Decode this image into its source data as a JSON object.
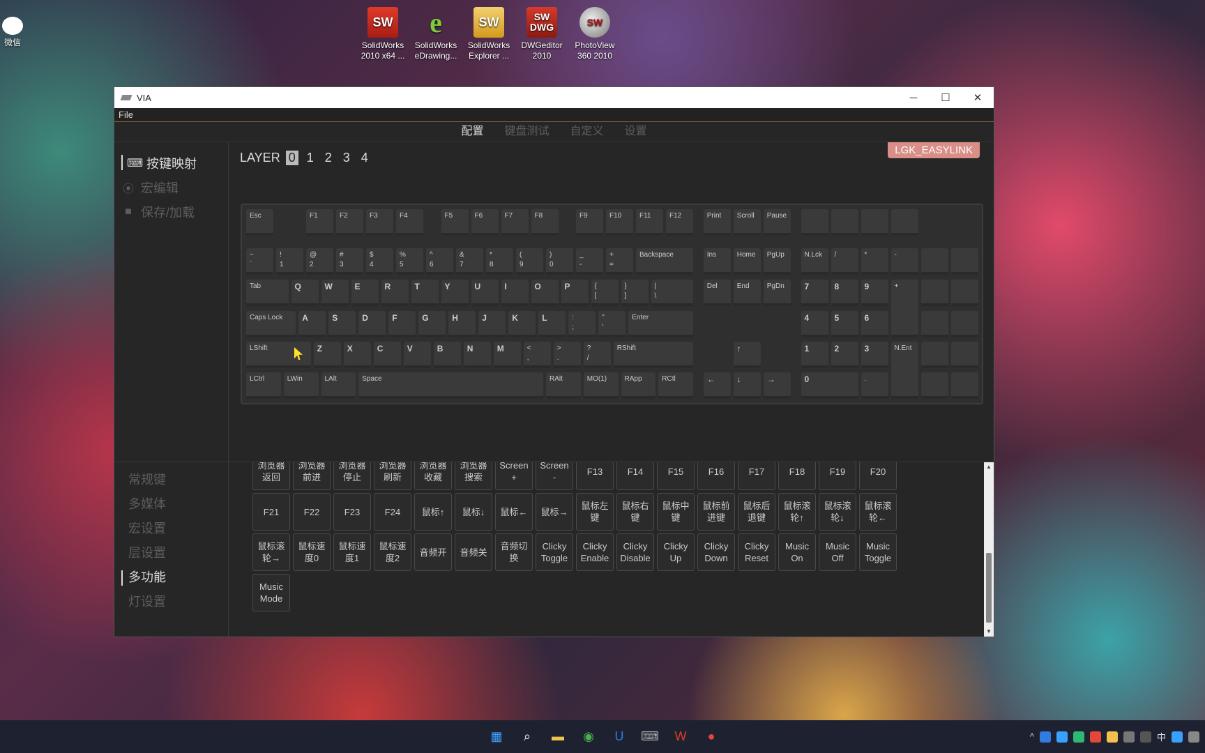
{
  "desktop_icons": [
    {
      "label": "微信",
      "icon": "wechat-icon"
    },
    {
      "label": "SolidWorks 2010 x64 ...",
      "icon": "solidworks-icon",
      "glyph": "SW"
    },
    {
      "label": "SolidWorks eDrawing...",
      "icon": "edrawings-icon",
      "glyph": "e"
    },
    {
      "label": "SolidWorks Explorer ...",
      "icon": "sw-explorer-icon",
      "glyph": "SW"
    },
    {
      "label": "DWGeditor 2010",
      "icon": "dwgeditor-icon",
      "glyph": "SW DWG"
    },
    {
      "label": "PhotoView 360 2010",
      "icon": "photoview-icon",
      "glyph": "SW"
    }
  ],
  "window": {
    "title": "VIA",
    "controls": {
      "minimize": "─",
      "maximize": "☐",
      "close": "✕"
    },
    "menu": {
      "file": "File"
    }
  },
  "top_tabs": [
    "配置",
    "键盘测试",
    "自定义",
    "设置"
  ],
  "top_tab_active": 0,
  "side_nav": [
    {
      "label": "按键映射",
      "icon": "keyboard-icon",
      "glyph": "⌨",
      "active": true
    },
    {
      "label": "宏编辑",
      "icon": "record-icon",
      "glyph": "⦿",
      "active": false
    },
    {
      "label": "保存/加载",
      "icon": "save-icon",
      "glyph": "■",
      "active": false
    }
  ],
  "layer": {
    "label": "LAYER",
    "numbers": [
      "0",
      "1",
      "2",
      "3",
      "4"
    ],
    "selected": 0
  },
  "device_badge": "LGK_EASYLINK",
  "keys": {
    "esc": "Esc",
    "f1": "F1",
    "f2": "F2",
    "f3": "F3",
    "f4": "F4",
    "f5": "F5",
    "f6": "F6",
    "f7": "F7",
    "f8": "F8",
    "f9": "F9",
    "f10": "F10",
    "f11": "F11",
    "f12": "F12",
    "print": "Print",
    "scroll": "Scroll",
    "pause": "Pause",
    "tilde": "~\n`",
    "k1": "!\n1",
    "k2": "@\n2",
    "k3": "#\n3",
    "k4": "$\n4",
    "k5": "%\n5",
    "k6": "^\n6",
    "k7": "&\n7",
    "k8": "*\n8",
    "k9": "(\n9",
    "k0": ")\n0",
    "minus": "_\n-",
    "equal": "+\n=",
    "backspace": "Backspace",
    "ins": "Ins",
    "home": "Home",
    "pgup": "PgUp",
    "nlck": "N.Lck",
    "nslash": "/",
    "nstar": "*",
    "nminus": "-",
    "tab": "Tab",
    "q": "Q",
    "w": "W",
    "e": "E",
    "r": "R",
    "t": "T",
    "y": "Y",
    "u": "U",
    "i": "I",
    "o": "O",
    "p": "P",
    "lbr": "{\n[",
    "rbr": "}\n]",
    "bslash": "|\n\\",
    "del": "Del",
    "end": "End",
    "pgdn": "PgDn",
    "n7": "7",
    "n8": "8",
    "n9": "9",
    "nplus": "+",
    "caps": "Caps Lock",
    "a": "A",
    "s": "S",
    "d": "D",
    "f": "F",
    "g": "G",
    "h": "H",
    "j": "J",
    "k": "K",
    "l": "L",
    "semi": ":\n;",
    "quote": "\"\n'",
    "enter": "Enter",
    "n4": "4",
    "n5": "5",
    "n6": "6",
    "lshift": "LShift",
    "z": "Z",
    "x": "X",
    "c": "C",
    "v": "V",
    "b": "B",
    "n": "N",
    "m": "M",
    "comma": "<\n,",
    "period": ">\n.",
    "slash": "?\n/",
    "rshift": "RShift",
    "up": "↑",
    "n1": "1",
    "n2": "2",
    "n3": "3",
    "nent": "N.Ent",
    "lctrl": "LCtrl",
    "lwin": "LWin",
    "lalt": "LAlt",
    "space": "Space",
    "ralt": "RAlt",
    "mo1": "MO(1)",
    "rapp": "RApp",
    "rctl": "RCtl",
    "left": "←",
    "down": "↓",
    "right": "→",
    "n0": "0",
    "ndot": "."
  },
  "lower_nav": [
    {
      "label": "常规键",
      "active": false
    },
    {
      "label": "多媒体",
      "active": false
    },
    {
      "label": "宏设置",
      "active": false
    },
    {
      "label": "层设置",
      "active": false
    },
    {
      "label": "多功能",
      "active": true
    },
    {
      "label": "灯设置",
      "active": false
    }
  ],
  "function_keys": [
    [
      "浏览器\n返回",
      "浏览器\n前进",
      "浏览器\n停止",
      "浏览器\n刷新",
      "浏览器\n收藏",
      "浏览器\n搜索",
      "Screen +",
      "Screen -",
      "F13",
      "F14",
      "F15",
      "F16",
      "F17",
      "F18",
      "F19",
      "F20"
    ],
    [
      "F21",
      "F22",
      "F23",
      "F24",
      "鼠标↑",
      "鼠标↓",
      "鼠标←",
      "鼠标→",
      "鼠标左\n键",
      "鼠标右\n键",
      "鼠标中\n键",
      "鼠标前\n进键",
      "鼠标后\n退键",
      "鼠标滚\n轮↑",
      "鼠标滚\n轮↓",
      "鼠标滚\n轮←"
    ],
    [
      "鼠标滚\n轮→",
      "鼠标速\n度0",
      "鼠标速\n度1",
      "鼠标速\n度2",
      "音频开",
      "音频关",
      "音频切\n换",
      "Clicky\nToggle",
      "Clicky\nEnable",
      "Clicky\nDisable",
      "Clicky\nUp",
      "Clicky\nDown",
      "Clicky\nReset",
      "Music\nOn",
      "Music\nOff",
      "Music\nToggle"
    ],
    [
      "Music\nMode"
    ]
  ],
  "taskbar": {
    "apps": [
      {
        "icon": "windows-start-icon",
        "glyph": "▦",
        "color": "#3aa0ff"
      },
      {
        "icon": "search-icon",
        "glyph": "⌕",
        "color": "#ffffff"
      },
      {
        "icon": "file-explorer-icon",
        "glyph": "▬",
        "color": "#f2c14e"
      },
      {
        "icon": "browser-icon",
        "glyph": "◉",
        "color": "#4caf50"
      },
      {
        "icon": "app-u-icon",
        "glyph": "U",
        "color": "#2f7de1"
      },
      {
        "icon": "via-icon",
        "glyph": "⌨",
        "color": "#aaaaaa"
      },
      {
        "icon": "wps-icon",
        "glyph": "W",
        "color": "#e03a2a"
      },
      {
        "icon": "recorder-icon",
        "glyph": "●",
        "color": "#e5463a"
      }
    ],
    "tray": {
      "chevron": "^",
      "ime": "中"
    }
  }
}
